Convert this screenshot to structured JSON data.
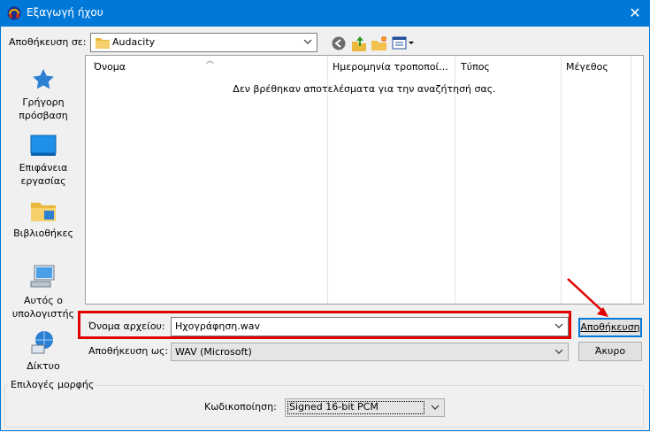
{
  "window": {
    "title": "Εξαγωγή ήχου",
    "close_glyph": "✕"
  },
  "toolbar": {
    "save_in_label": "Αποθήκευση σε:",
    "current_folder": "Audacity",
    "icons": [
      "back-icon",
      "up-folder-icon",
      "new-folder-icon",
      "view-menu-icon"
    ]
  },
  "places": [
    {
      "label": "Γρήγορη πρόσβαση",
      "icon": "star-icon"
    },
    {
      "label": "Επιφάνεια εργασίας",
      "icon": "desktop-icon"
    },
    {
      "label": "Βιβλιοθήκες",
      "icon": "libraries-icon"
    },
    {
      "label": "Αυτός ο υπολογιστής",
      "icon": "computer-icon"
    },
    {
      "label": "Δίκτυο",
      "icon": "network-icon"
    }
  ],
  "file_list": {
    "columns": [
      "Όνομα",
      "Ημερομηνία τροποποί...",
      "Τύπος",
      "Μέγεθος"
    ],
    "empty_message": "Δεν βρέθηκαν αποτελέσματα για την αναζήτησή σας."
  },
  "filename": {
    "label": "Όνομα αρχείου:",
    "value": "Ηχογράφηση.wav"
  },
  "save_type": {
    "label": "Αποθήκευση ως:",
    "value": "WAV (Microsoft)"
  },
  "buttons": {
    "save": "Αποθήκευση",
    "cancel": "Άκυρο"
  },
  "format_options": {
    "group_label": "Επιλογές μορφής",
    "encoding_label": "Κωδικοποίηση:",
    "encoding_value": "Signed 16-bit PCM"
  },
  "colors": {
    "titlebar": "#0078d7",
    "highlight": "#e00000"
  }
}
